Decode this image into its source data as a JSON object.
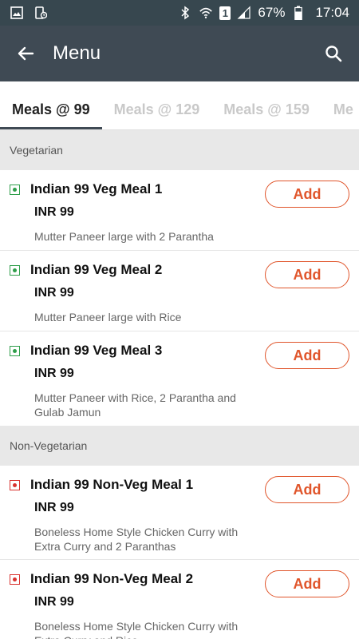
{
  "statusbar": {
    "battery": "67%",
    "time": "17:04",
    "sim": "1"
  },
  "appbar": {
    "title": "Menu"
  },
  "tabs": [
    {
      "label": "Meals @ 99",
      "active": true
    },
    {
      "label": "Meals @ 129",
      "active": false
    },
    {
      "label": "Meals @ 159",
      "active": false
    },
    {
      "label": "Me",
      "active": false
    }
  ],
  "sections": {
    "veg": {
      "title": "Vegetarian",
      "items": [
        {
          "name": "Indian 99 Veg Meal 1",
          "price": "INR 99",
          "desc": "Mutter Paneer large with 2 Parantha",
          "add": "Add"
        },
        {
          "name": "Indian 99 Veg Meal 2",
          "price": "INR 99",
          "desc": "Mutter Paneer large with Rice",
          "add": "Add"
        },
        {
          "name": "Indian 99 Veg Meal 3",
          "price": "INR 99",
          "desc": "Mutter Paneer with Rice, 2 Parantha and Gulab Jamun",
          "add": "Add"
        }
      ]
    },
    "nonveg": {
      "title": "Non-Vegetarian",
      "items": [
        {
          "name": "Indian 99 Non-Veg Meal 1",
          "price": "INR 99",
          "desc": "Boneless Home Style Chicken Curry with Extra Curry and 2 Paranthas",
          "add": "Add"
        },
        {
          "name": "Indian 99 Non-Veg Meal 2",
          "price": "INR 99",
          "desc": "Boneless Home Style Chicken Curry with Extra Curry and Rice",
          "add": "Add"
        }
      ]
    }
  },
  "colors": {
    "appbar": "#3f4a54",
    "statusbar": "#37474f",
    "accent": "#e0552b",
    "veg": "#2e9e4a",
    "nonveg": "#d9322e"
  }
}
